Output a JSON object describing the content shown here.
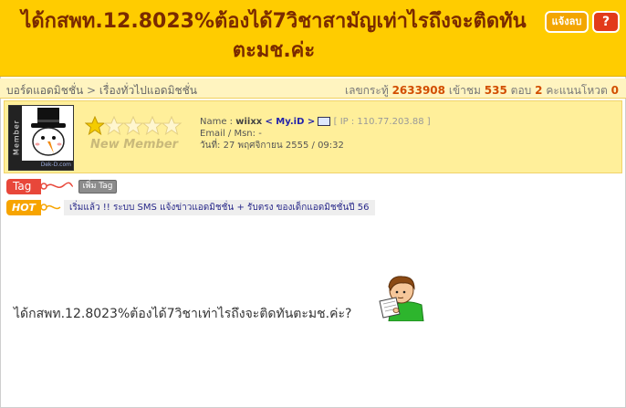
{
  "header": {
    "title": "ได้กสพท.12.8023%ต้องได้7วิชาสามัญเท่าไรถึงจะติดทันตะมช.ค่ะ",
    "report_label": "แจ้งลบ",
    "help_label": "?"
  },
  "breadcrumb": {
    "board": "บอร์ดแอดมิชชั่น",
    "separator": ">",
    "category": "เรื่องทั่วไปแอดมิชชั่น"
  },
  "stats": {
    "topic_label": "เลขกระทู้",
    "topic_id": "2633908",
    "views_label": "เข้าชม",
    "views": "535",
    "replies_label": "ตอบ",
    "replies": "2",
    "score_label": "คะแนนโหวต",
    "score": "0"
  },
  "author": {
    "avatar_side_text": "Member",
    "avatar_foot_text": "Dek-D.com",
    "rank": "New Member",
    "stars_filled": 1,
    "stars_total": 5,
    "name_label": "Name :",
    "name": "wiixx",
    "myid_label": "< My.iD >",
    "ip_text": "[ IP : 110.77.203.88 ]",
    "email_label": "Email / Msn: -",
    "date_text": "วันที่: 27 พฤศจิกายน 2555 / 09:32"
  },
  "tags": {
    "tag_label": "Tag",
    "add_tag_label": "เพิ่ม Tag",
    "hot_label": "HOT",
    "hot_link": "เริ่มแล้ว !! ระบบ SMS แจ้งข่าวแอดมิชชั่น + รับตรง ของเด็กแอดมิชชั่นปี 56"
  },
  "post": {
    "body_text": "ได้กสพท.12.8023%ต้องได้7วิชาเท่าไรถึงจะติดทันตะมช.ค่ะ?"
  },
  "colors": {
    "header_bg": "#ffcc00",
    "title": "#7a2a00",
    "stat_number": "#d24e00",
    "tag_badge": "#e8473a",
    "hot_badge": "#f7a400"
  }
}
